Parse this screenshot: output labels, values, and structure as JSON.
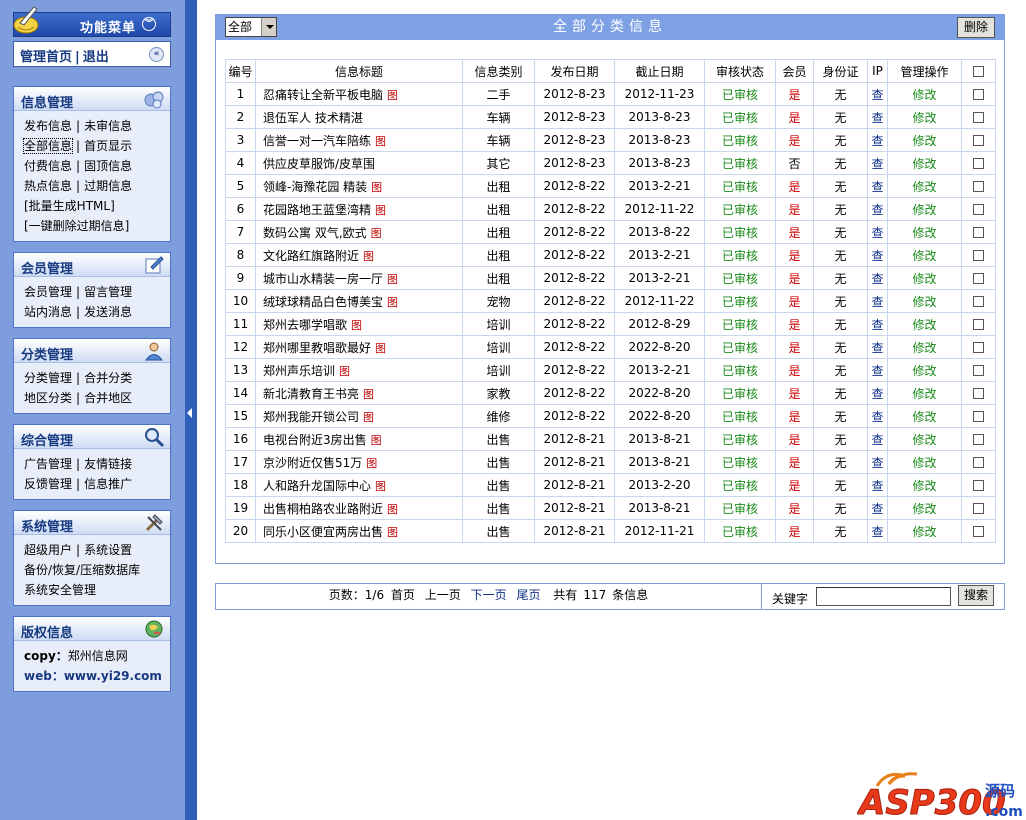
{
  "sidebar": {
    "menu_title": "功能菜单",
    "home_label": "管理首页",
    "logout_label": "退出",
    "panels": [
      {
        "title": "信息管理",
        "icon": "gear-cluster-icon",
        "rows": [
          [
            "发布信息",
            "未审信息"
          ],
          [
            "全部信息",
            "首页显示"
          ],
          [
            "付费信息",
            "固顶信息"
          ],
          [
            "热点信息",
            "过期信息"
          ],
          [
            "[批量生成HTML]"
          ],
          [
            "[一键删除过期信息]"
          ]
        ]
      },
      {
        "title": "会员管理",
        "icon": "edit-note-icon",
        "rows": [
          [
            "会员管理",
            "留言管理"
          ],
          [
            "站内消息",
            "发送消息"
          ]
        ]
      },
      {
        "title": "分类管理",
        "icon": "user-icon",
        "rows": [
          [
            "分类管理",
            "合并分类"
          ],
          [
            "地区分类",
            "合并地区"
          ]
        ]
      },
      {
        "title": "综合管理",
        "icon": "magnifier-icon",
        "rows": [
          [
            "广告管理",
            "友情链接"
          ],
          [
            "反馈管理",
            "信息推广"
          ]
        ]
      },
      {
        "title": "系统管理",
        "icon": "tools-icon",
        "rows": [
          [
            "超级用户",
            "系统设置"
          ],
          [
            "备份/恢复/压缩数据库"
          ],
          [
            "系统安全管理"
          ]
        ]
      }
    ],
    "copyright": {
      "title": "版权信息",
      "icon": "globe-icon",
      "copy_label": "copy：",
      "copy_value": "郑州信息网",
      "web_label": "web：",
      "web_value": "www.yi29.com"
    }
  },
  "main": {
    "title": "全部分类信息",
    "filter_value": "全部",
    "delete_label": "删除",
    "columns": [
      "编号",
      "信息标题",
      "信息类别",
      "发布日期",
      "截止日期",
      "审核状态",
      "会员",
      "身份证",
      "IP",
      "管理操作"
    ],
    "image_marker": "图",
    "view_label": "查",
    "edit_label": "修改",
    "rows": [
      {
        "id": "1",
        "title": "忍痛转让全新平板电脑",
        "img": true,
        "category": "二手",
        "pub": "2012-8-23",
        "end": "2012-11-23",
        "status": "已审核",
        "vip": "是",
        "idcard": "无"
      },
      {
        "id": "2",
        "title": "退伍军人 技术精湛",
        "img": false,
        "category": "车辆",
        "pub": "2012-8-23",
        "end": "2013-8-23",
        "status": "已审核",
        "vip": "是",
        "idcard": "无"
      },
      {
        "id": "3",
        "title": "信誉一对一汽车陪练",
        "img": true,
        "category": "车辆",
        "pub": "2012-8-23",
        "end": "2013-8-23",
        "status": "已审核",
        "vip": "是",
        "idcard": "无"
      },
      {
        "id": "4",
        "title": "供应皮草服饰/皮草围",
        "img": false,
        "category": "其它",
        "pub": "2012-8-23",
        "end": "2013-8-23",
        "status": "已审核",
        "vip": "否",
        "idcard": "无"
      },
      {
        "id": "5",
        "title": "领峰-海豫花园 精装",
        "img": true,
        "category": "出租",
        "pub": "2012-8-22",
        "end": "2013-2-21",
        "status": "已审核",
        "vip": "是",
        "idcard": "无"
      },
      {
        "id": "6",
        "title": "花园路地王蓝堡湾精",
        "img": true,
        "category": "出租",
        "pub": "2012-8-22",
        "end": "2012-11-22",
        "status": "已审核",
        "vip": "是",
        "idcard": "无"
      },
      {
        "id": "7",
        "title": "数码公寓 双气,欧式",
        "img": true,
        "category": "出租",
        "pub": "2012-8-22",
        "end": "2013-8-22",
        "status": "已审核",
        "vip": "是",
        "idcard": "无"
      },
      {
        "id": "8",
        "title": "文化路红旗路附近",
        "img": true,
        "category": "出租",
        "pub": "2012-8-22",
        "end": "2013-2-21",
        "status": "已审核",
        "vip": "是",
        "idcard": "无"
      },
      {
        "id": "9",
        "title": "城市山水精装一房一厅",
        "img": true,
        "category": "出租",
        "pub": "2012-8-22",
        "end": "2013-2-21",
        "status": "已审核",
        "vip": "是",
        "idcard": "无"
      },
      {
        "id": "10",
        "title": "绒球球精品白色博美宝",
        "img": true,
        "category": "宠物",
        "pub": "2012-8-22",
        "end": "2012-11-22",
        "status": "已审核",
        "vip": "是",
        "idcard": "无"
      },
      {
        "id": "11",
        "title": "郑州去哪学唱歌",
        "img": true,
        "category": "培训",
        "pub": "2012-8-22",
        "end": "2012-8-29",
        "status": "已审核",
        "vip": "是",
        "idcard": "无"
      },
      {
        "id": "12",
        "title": "郑州哪里教唱歌最好",
        "img": true,
        "category": "培训",
        "pub": "2012-8-22",
        "end": "2022-8-20",
        "status": "已审核",
        "vip": "是",
        "idcard": "无"
      },
      {
        "id": "13",
        "title": "郑州声乐培训",
        "img": true,
        "category": "培训",
        "pub": "2012-8-22",
        "end": "2013-2-21",
        "status": "已审核",
        "vip": "是",
        "idcard": "无"
      },
      {
        "id": "14",
        "title": "新北清教育王书亮",
        "img": true,
        "category": "家教",
        "pub": "2012-8-22",
        "end": "2022-8-20",
        "status": "已审核",
        "vip": "是",
        "idcard": "无"
      },
      {
        "id": "15",
        "title": "郑州我能开锁公司",
        "img": true,
        "category": "维修",
        "pub": "2012-8-22",
        "end": "2022-8-20",
        "status": "已审核",
        "vip": "是",
        "idcard": "无"
      },
      {
        "id": "16",
        "title": "电视台附近3房出售",
        "img": true,
        "category": "出售",
        "pub": "2012-8-21",
        "end": "2013-8-21",
        "status": "已审核",
        "vip": "是",
        "idcard": "无"
      },
      {
        "id": "17",
        "title": "京沙附近仅售51万",
        "img": true,
        "category": "出售",
        "pub": "2012-8-21",
        "end": "2013-8-21",
        "status": "已审核",
        "vip": "是",
        "idcard": "无"
      },
      {
        "id": "18",
        "title": "人和路升龙国际中心",
        "img": true,
        "category": "出售",
        "pub": "2012-8-21",
        "end": "2013-2-20",
        "status": "已审核",
        "vip": "是",
        "idcard": "无"
      },
      {
        "id": "19",
        "title": "出售桐柏路农业路附近",
        "img": true,
        "category": "出售",
        "pub": "2012-8-21",
        "end": "2013-8-21",
        "status": "已审核",
        "vip": "是",
        "idcard": "无"
      },
      {
        "id": "20",
        "title": "同乐小区便宜两房出售",
        "img": true,
        "category": "出售",
        "pub": "2012-8-21",
        "end": "2012-11-21",
        "status": "已审核",
        "vip": "是",
        "idcard": "无"
      }
    ]
  },
  "pager": {
    "pages_label": "页数：1/6",
    "first": "首页",
    "prev": "上一页",
    "next": "下一页",
    "last": "尾页",
    "total_prefix": "共有",
    "total_count": "117",
    "total_suffix": "条信息",
    "keyword_label": "关键字",
    "keyword_value": "",
    "search_label": "搜索"
  },
  "watermark": {
    "brand": "ASP300",
    "suffix_top": "源码",
    "suffix_bottom": ".com"
  },
  "colors": {
    "sidebar_bg": "#7e9ddd",
    "header_bg": "#7ea1e6",
    "status_green": "#1a8a1a",
    "vip_red": "#d00000",
    "watermark_red": "#e83a1a"
  }
}
